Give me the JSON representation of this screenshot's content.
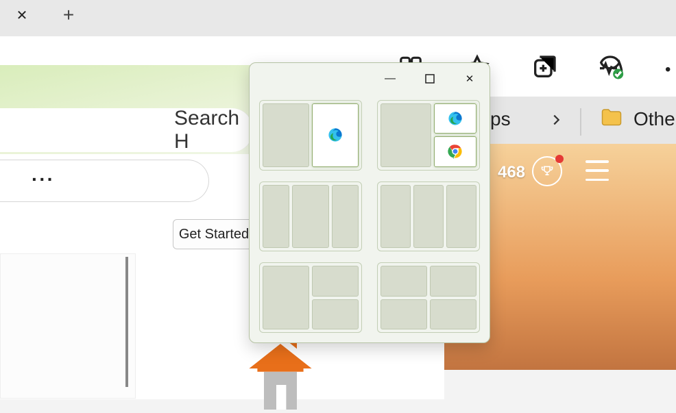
{
  "tabs": {
    "close_glyph": "✕",
    "new_tab_glyph": "+"
  },
  "search": {
    "placeholder_fragment": "Search H"
  },
  "toolbar": {
    "more_glyph": "···",
    "get_started_label": "Get Started",
    "ps_label_fragment": "ps",
    "other_label_fragment": "Othe",
    "overflow_glyph": "•"
  },
  "rewards": {
    "points": "468"
  },
  "window_controls": {
    "minimize_glyph": "—",
    "maximize_glyph": "▢",
    "close_glyph": "✕"
  },
  "snap_layouts": {
    "active_window_icon": "edge",
    "preview_icons": [
      "edge",
      "chrome"
    ]
  }
}
